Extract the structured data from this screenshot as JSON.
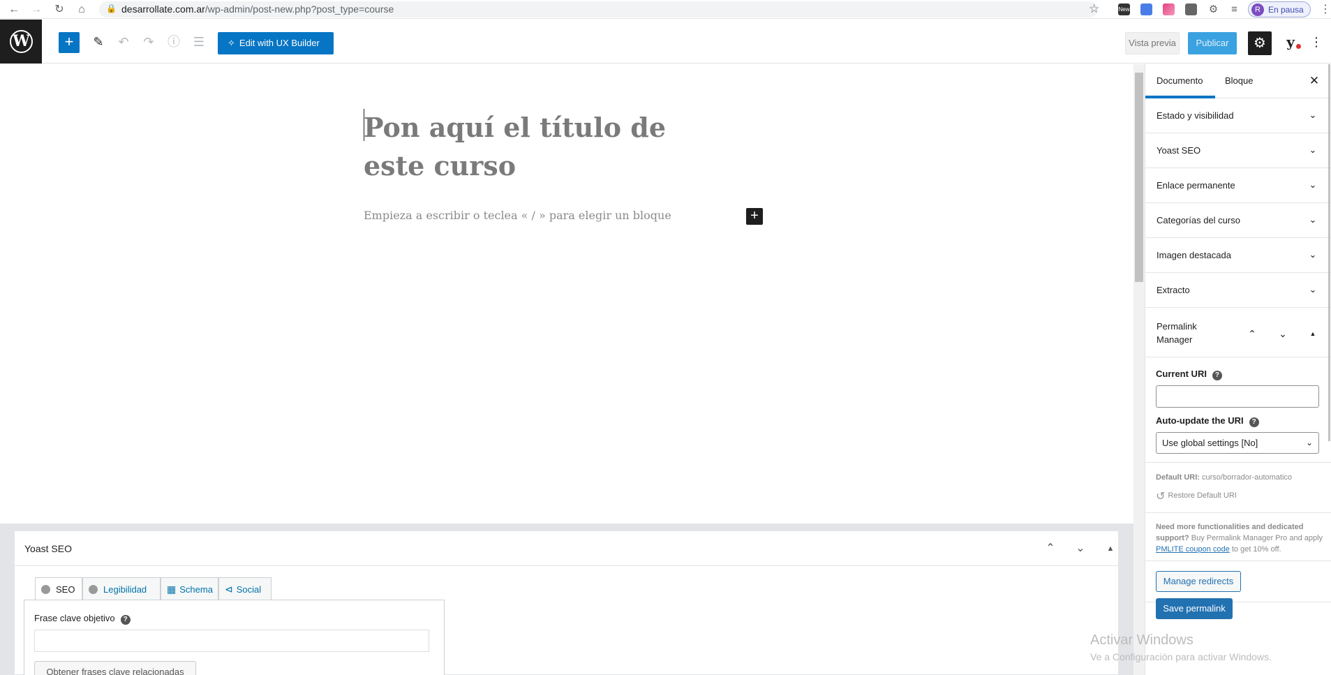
{
  "browser": {
    "url_domain": "desarrollate.com.ar",
    "url_path": "/wp-admin/post-new.php?post_type=course",
    "profile_initial": "R",
    "profile_status": "En pausa",
    "ext_new_label": "New"
  },
  "toolbar": {
    "logo_letter": "W",
    "ux_builder_label": "Edit with UX Builder",
    "preview_label": "Vista previa",
    "publish_label": "Publicar"
  },
  "editor": {
    "title_placeholder": "Pon aquí el título de este curso",
    "block_placeholder": "Empieza a escribir o teclea « / » para elegir un bloque"
  },
  "sidebar": {
    "tabs": [
      {
        "label": "Documento",
        "active": true
      },
      {
        "label": "Bloque",
        "active": false
      }
    ],
    "sections": [
      {
        "label": "Estado y visibilidad"
      },
      {
        "label": "Yoast SEO"
      },
      {
        "label": "Enlace permanente"
      },
      {
        "label": "Categorías del curso"
      },
      {
        "label": "Imagen destacada"
      },
      {
        "label": "Extracto"
      }
    ],
    "permalink_manager": {
      "title": "Permalink Manager",
      "current_uri_label": "Current URI",
      "current_uri_value": "",
      "auto_update_label": "Auto-update the URI",
      "auto_update_selected": "Use global settings [No]",
      "default_uri_label": "Default URI:",
      "default_uri_value": "curso/borrador-automatico",
      "restore_label": "Restore Default URI",
      "promo_bold": "Need more functionalities and dedicated support?",
      "promo_text": "Buy Permalink Manager Pro and apply",
      "promo_link": "PMLITE coupon code",
      "promo_tail": "to get 10% off.",
      "manage_redirects_label": "Manage redirects",
      "save_label": "Save permalink"
    }
  },
  "yoast_panel": {
    "title": "Yoast SEO",
    "tabs": [
      {
        "label": "SEO",
        "active": true
      },
      {
        "label": "Legibilidad",
        "active": false
      },
      {
        "label": "Schema",
        "active": false
      },
      {
        "label": "Social",
        "active": false
      }
    ],
    "focus_keyphrase_label": "Frase clave objetivo",
    "focus_keyphrase_value": "",
    "related_button_label": "Obtener frases clave relacionadas"
  },
  "watermark": {
    "title": "Activar Windows",
    "subtitle": "Ve a Configuración para activar Windows."
  },
  "colors": {
    "wp_blue": "#0675c4",
    "publish_disabled": "#3aa2e0",
    "admin_dark": "#1e1e1e",
    "link_blue": "#2271b1"
  }
}
